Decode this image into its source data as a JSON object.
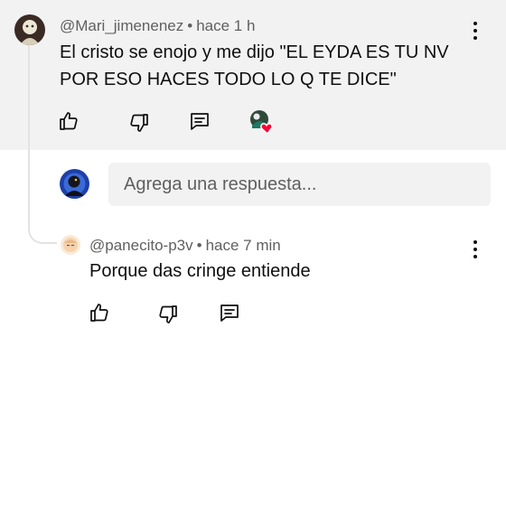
{
  "comment": {
    "author": "@Mari_jimenenez",
    "separator": "•",
    "time": "hace 1 h",
    "text": "El cristo se enojo y me dijo \"EL EYDA ES TU NV POR ESO HACES TODO LO Q TE DICE\""
  },
  "reply_box": {
    "placeholder": "Agrega una respuesta..."
  },
  "reply": {
    "author": "@panecito-p3v",
    "separator": "•",
    "time": "hace 7 min",
    "text": "Porque das cringe entiende"
  },
  "icons": {
    "like": "thumbs-up-icon",
    "dislike": "thumbs-down-icon",
    "reply": "comment-icon",
    "more": "more-vertical-icon",
    "creator_heart": "creator-heart-icon"
  },
  "colors": {
    "heart": "#ff0033",
    "comment_background": "#f2f2f2",
    "secondary_text": "#606060"
  }
}
